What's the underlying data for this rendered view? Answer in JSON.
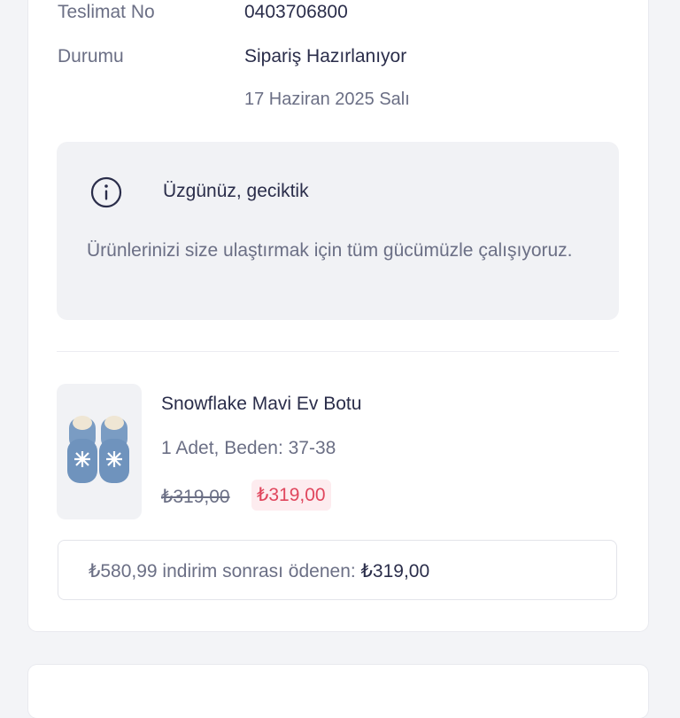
{
  "order": {
    "delivery_no_label": "Teslimat No",
    "delivery_no_value": "0403706800",
    "status_label": "Durumu",
    "status_value": "Sipariş Hazırlanıyor",
    "status_date": "17 Haziran 2025 Salı"
  },
  "notice": {
    "icon": "info-icon",
    "title": "Üzgünüz, geciktik",
    "text": "Ürünlerinizi size ulaştırmak için tüm gücümüzle çalışıyoruz."
  },
  "product": {
    "name": "Snowflake Mavi Ev Botu",
    "meta": "1 Adet, Beden: 37-38",
    "price_old": "₺319,00",
    "price_new": "₺319,00"
  },
  "summary": {
    "text": "₺580,99 indirim sonrası ödenen: ",
    "amount": "₺319,00"
  },
  "colors": {
    "text_primary": "#2a2d4a",
    "text_secondary": "#6b6f85",
    "discount_red": "#e0465d",
    "discount_bg": "#fdecef",
    "panel_bg": "#f1f2f5"
  }
}
